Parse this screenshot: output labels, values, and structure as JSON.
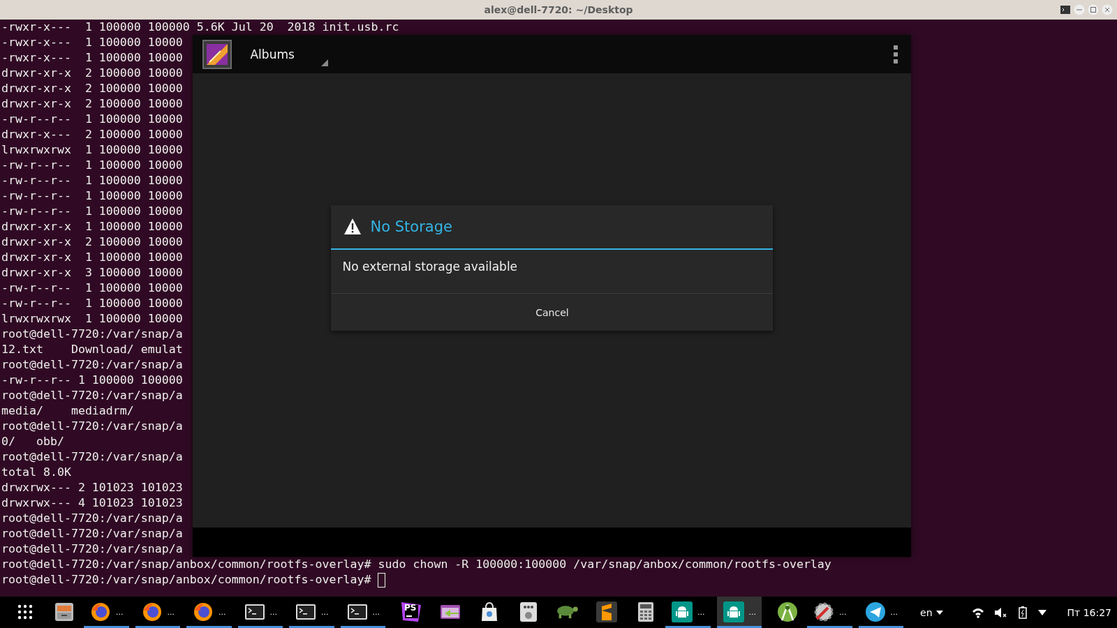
{
  "window": {
    "title": "alex@dell-7720: ~/Desktop"
  },
  "terminal": {
    "lines": [
      "-rwxr-x---  1 100000 100000 5.6K Jul 20  2018 init.usb.rc",
      "-rwxr-x---  1 100000 10000",
      "-rwxr-x---  1 100000 10000",
      "drwxr-xr-x  2 100000 10000",
      "drwxr-xr-x  2 100000 10000",
      "drwxr-xr-x  2 100000 10000",
      "-rw-r--r--  1 100000 10000",
      "drwxr-x---  2 100000 10000",
      "lrwxrwxrwx  1 100000 10000",
      "-rw-r--r--  1 100000 10000",
      "-rw-r--r--  1 100000 10000",
      "-rw-r--r--  1 100000 10000",
      "-rw-r--r--  1 100000 10000",
      "drwxr-xr-x  1 100000 10000",
      "drwxr-xr-x  2 100000 10000",
      "drwxr-xr-x  1 100000 10000",
      "drwxr-xr-x  3 100000 10000",
      "-rw-r--r--  1 100000 10000",
      "-rw-r--r--  1 100000 10000",
      "lrwxrwxrwx  1 100000 10000",
      "root@dell-7720:/var/snap/a",
      "12.txt    Download/ emulat",
      "root@dell-7720:/var/snap/a",
      "-rw-r--r-- 1 100000 100000",
      "root@dell-7720:/var/snap/a",
      "media/    mediadrm/",
      "root@dell-7720:/var/snap/a",
      "0/   obb/",
      "root@dell-7720:/var/snap/a",
      "total 8.0K",
      "drwxrwx--- 2 101023 101023",
      "drwxrwx--- 4 101023 101023",
      "root@dell-7720:/var/snap/a",
      "root@dell-7720:/var/snap/a",
      "root@dell-7720:/var/snap/a",
      "root@dell-7720:/var/snap/anbox/common/rootfs-overlay# sudo chown -R 100000:100000 /var/snap/anbox/common/rootfs-overlay",
      "root@dell-7720:/var/snap/anbox/common/rootfs-overlay# "
    ]
  },
  "app": {
    "title": "Albums",
    "dialog": {
      "title": "No Storage",
      "message": "No external storage available",
      "button": "Cancel"
    }
  },
  "taskbar": {
    "items": [
      {
        "kind": "grid",
        "running": false,
        "selected": false
      },
      {
        "kind": "cabinet",
        "running": false,
        "selected": false
      },
      {
        "kind": "firefox",
        "dots": "...",
        "running": true,
        "selected": false
      },
      {
        "kind": "firefox",
        "dots": "...",
        "running": true,
        "selected": false
      },
      {
        "kind": "firefox",
        "dots": "...",
        "running": true,
        "selected": false
      },
      {
        "kind": "terminal",
        "dots": "...",
        "running": true,
        "selected": false
      },
      {
        "kind": "terminal",
        "dots": "...",
        "running": true,
        "selected": false
      },
      {
        "kind": "terminal",
        "dots": "...",
        "running": true,
        "selected": false
      },
      {
        "kind": "phpstorm",
        "badge": "PS",
        "running": false,
        "selected": false
      },
      {
        "kind": "transfer",
        "running": false,
        "selected": false
      },
      {
        "kind": "bag",
        "running": false,
        "selected": false
      },
      {
        "kind": "device",
        "running": false,
        "selected": false
      },
      {
        "kind": "turtle",
        "running": false,
        "selected": false
      },
      {
        "kind": "sublime",
        "running": false,
        "selected": false
      },
      {
        "kind": "calculator",
        "running": false,
        "selected": false
      },
      {
        "kind": "android",
        "dots": "...",
        "running": true,
        "selected": false
      },
      {
        "kind": "android",
        "dots": "...",
        "running": true,
        "selected": true
      },
      {
        "kind": "studio",
        "running": false,
        "selected": false
      },
      {
        "kind": "tools",
        "dots": "...",
        "running": true,
        "selected": false
      },
      {
        "kind": "telegram",
        "dots": "...",
        "running": true,
        "selected": false
      }
    ],
    "language": "en",
    "clock": "Пт 16:27"
  }
}
